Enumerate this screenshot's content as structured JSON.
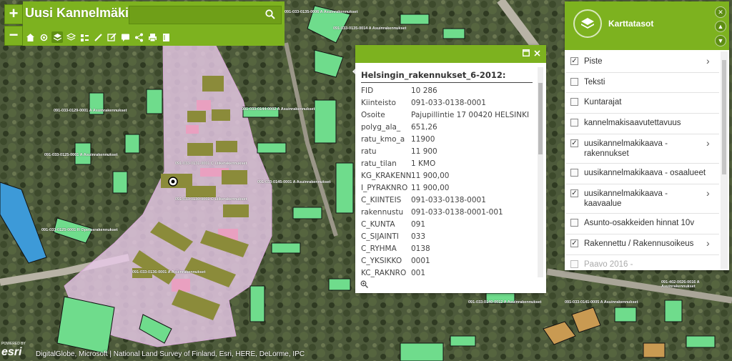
{
  "app": {
    "title": "Uusi Kannelmäki"
  },
  "zoom": {
    "in_label": "+",
    "out_label": "−"
  },
  "search": {
    "value": "",
    "placeholder": ""
  },
  "toolbar": {
    "tools": [
      "home-icon",
      "locate-icon",
      "layers-icon",
      "basemap-icon",
      "legend-icon",
      "draw-icon",
      "edit-icon",
      "comment-icon",
      "share-icon",
      "print-icon",
      "bookmark-icon"
    ]
  },
  "popup": {
    "title": "Helsingin_rakennukset_6-2012:",
    "fields": [
      {
        "key": "FID",
        "value": "10 286"
      },
      {
        "key": "Kiinteisto",
        "value": "091-033-0138-0001"
      },
      {
        "key": "Osoite",
        "value": "Pajupillintie 17 00420 HELSINKI"
      },
      {
        "key": "polyg_ala_",
        "value": "651,26"
      },
      {
        "key": "ratu_kmo_a",
        "value": "11900"
      },
      {
        "key": "ratu",
        "value": "11 900"
      },
      {
        "key": "ratu_tilan",
        "value": "1 KMO"
      },
      {
        "key": "KG_KRAKENN",
        "value": "11 900,00"
      },
      {
        "key": "I_PYRAKNRO",
        "value": "11 900,00"
      },
      {
        "key": "C_KIINTEIS",
        "value": "091-033-0138-0001"
      },
      {
        "key": "rakennustu",
        "value": "091-033-0138-0001-001"
      },
      {
        "key": "C_KUNTA",
        "value": "091"
      },
      {
        "key": "C_SIJAINTI",
        "value": "033"
      },
      {
        "key": "C_RYHMA",
        "value": "0138"
      },
      {
        "key": "C_YKSIKKO",
        "value": "0001"
      },
      {
        "key": "KC_RAKNRO",
        "value": "001"
      }
    ]
  },
  "layers": {
    "title": "Karttatasot",
    "items": [
      {
        "label": "Piste",
        "checked": true,
        "expand": true
      },
      {
        "label": "Teksti",
        "checked": false,
        "expand": false
      },
      {
        "label": "Kuntarajat",
        "checked": false,
        "expand": false
      },
      {
        "label": "kannelmakisaavutettavuus",
        "checked": false,
        "expand": false
      },
      {
        "label": "uusikannelmakikaava - rakennukset",
        "checked": true,
        "expand": true
      },
      {
        "label": "uusikannelmakikaava - osaalueet",
        "checked": false,
        "expand": false
      },
      {
        "label": "uusikannelmakikaava - kaavaalue",
        "checked": true,
        "expand": true
      },
      {
        "label": "Asunto-osakkeiden hinnat 10v",
        "checked": false,
        "expand": false
      },
      {
        "label": "Rakennettu / Rakennusoikeus",
        "checked": true,
        "expand": true
      },
      {
        "label": "Paavo 2016 -",
        "checked": false,
        "expand": false
      }
    ]
  },
  "map": {
    "parcel_labels": [
      "091-033-0135-0006 A Asuinrakennukset",
      "091-033-0135-0014 A Asuinrakennukset",
      "091-033-0129-0001 A Asuinrakennukset",
      "091-033-0144-0002 A Asuinrakennukset",
      "091-033-0131-0001 C Liikerakennukset",
      "091-033-0130-0001 C Liikerakennukset",
      "091-033-0145-0001 A Asuinrakennukset",
      "091-033-0125-0001 A Asuinrakennukset",
      "091-033-0125-0001 R Opetusrakennukset",
      "091-033-0136-0001 A Asuinrakennukset",
      "091-033-0140-0012 A Asuinrakennukset",
      "091-033-0141-0005 A Asuinrakennukset",
      "091-402-0026-0016 A Asuinrakennukset"
    ]
  },
  "attribution": {
    "powered": "POWERED BY",
    "brand": "esri",
    "text": "DigitalGlobe, Microsoft | National Land Survey of Finland, Esri, HERE, DeLorme, IPC"
  },
  "colors": {
    "accent": "#7db21f",
    "plan_area": "#e8c9e8",
    "building": "#6fdc8c",
    "olive": "#8b8b3a"
  }
}
